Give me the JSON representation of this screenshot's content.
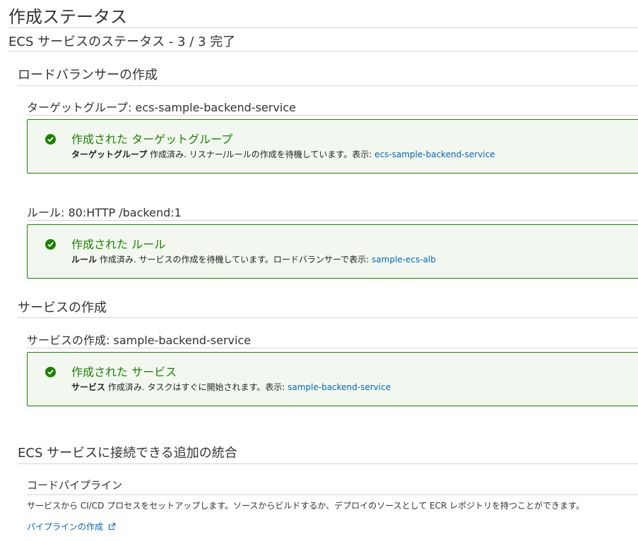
{
  "page": {
    "title": "作成ステータス",
    "subtitle": "ECS サービスのステータス - 3 / 3 完了"
  },
  "load_balancer": {
    "heading": "ロードバランサーの作成",
    "target_group": {
      "heading": "ターゲットグループ: ecs-sample-backend-service",
      "alert_title": "作成された ターゲットグループ",
      "alert_bold": "ターゲットグループ",
      "alert_text": " 作成済み. リスナー/ルールの作成を待機しています。表示: ",
      "alert_link": "ecs-sample-backend-service"
    },
    "rule": {
      "heading": "ルール: 80:HTTP /backend:1",
      "alert_title": "作成された ルール",
      "alert_bold": "ルール",
      "alert_text": " 作成済み. サービスの作成を待機しています。ロードバランサーで表示: ",
      "alert_link": "sample-ecs-alb"
    }
  },
  "service": {
    "heading": "サービスの作成",
    "sub_heading": "サービスの作成: sample-backend-service",
    "alert_title": "作成された サービス",
    "alert_bold": "サービス",
    "alert_text": " 作成済み. タスクはすぐに開始されます。表示: ",
    "alert_link": "sample-backend-service"
  },
  "integrations": {
    "heading": "ECS サービスに接続できる追加の統合",
    "code_pipeline": {
      "heading": "コードパイプライン",
      "description": "サービスから CI/CD プロセスをセットアップします。ソースからビルドするか、デプロイのソースとして ECR レポジトリを持つことができます。",
      "link_label": "パイプラインの作成"
    }
  },
  "colors": {
    "success": "#1d8102",
    "link": "#0066c0",
    "divider": "#d5d5d5"
  }
}
